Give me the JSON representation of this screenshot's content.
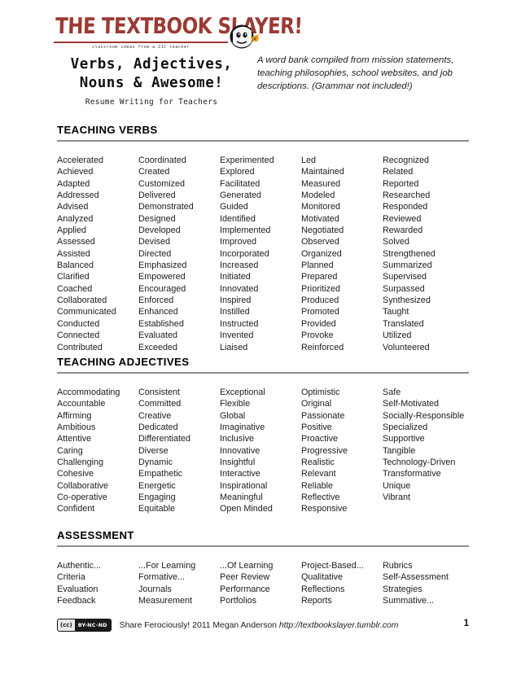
{
  "header": {
    "brand_title": "THE TEXTBOOK SLAYER!",
    "brand_tagline": "classroom  ideas from a 21C teacher",
    "brand_color": "#9b3a33",
    "doc_title_line1": "Verbs, Adjectives,",
    "doc_title_line2": "Nouns & Awesome!",
    "doc_subtitle": "Resume Writing for Teachers",
    "blurb": "A word bank compiled from mission statements, teaching philosophies, school websites, and job descriptions. (Grammar not included!)",
    "mascot_icon": "slayer-mascot-icon"
  },
  "sections": [
    {
      "id": "verbs",
      "title": "TEACHING VERBS",
      "columns": [
        [
          "Accelerated",
          "Achieved",
          "Adapted",
          "Addressed",
          "Advised",
          "Analyzed",
          "Applied",
          "Assessed",
          "Assisted",
          "Balanced",
          "Clarified",
          "Coached",
          "Collaborated",
          "Communicated",
          "Conducted",
          "Connected",
          "Contributed"
        ],
        [
          "Coordinated",
          "Created",
          "Customized",
          "Delivered",
          "Demonstrated",
          "Designed",
          "Developed",
          "Devised",
          "Directed",
          "Emphasized",
          "Empowered",
          "Encouraged",
          "Enforced",
          "Enhanced",
          "Established",
          "Evaluated",
          "Exceeded"
        ],
        [
          "Experimented",
          "Explored",
          "Facilitated",
          "Generated",
          "Guided",
          "Identified",
          "Implemented",
          "Improved",
          "Incorporated",
          "Increased",
          "Initiated",
          "Innovated",
          "Inspired",
          "Instilled",
          "Instructed",
          "Invented",
          "Liaised"
        ],
        [
          "Led",
          "Maintained",
          "Measured",
          "Modeled",
          "Monitored",
          "Motivated",
          "Negotiated",
          "Observed",
          "Organized",
          "Planned",
          "Prepared",
          "Prioritized",
          "Produced",
          "Promoted",
          "Provided",
          "Provoke",
          "Reinforced"
        ],
        [
          "Recognized",
          "Related",
          "Reported",
          "Researched",
          "Responded",
          "Reviewed",
          "Rewarded",
          "Solved",
          "Strengthened",
          "Summarized",
          "Supervised",
          "Surpassed",
          "Synthesized",
          "Taught",
          "Translated",
          "Utilized",
          "Volunteered"
        ]
      ]
    },
    {
      "id": "adjectives",
      "title": "TEACHING ADJECTIVES",
      "columns": [
        [
          "Accommodating",
          "Accountable",
          "Affirming",
          "Ambitious",
          "Attentive",
          "Caring",
          "Challenging",
          "Cohesive",
          "Collaborative",
          "Co-operative",
          "Confident"
        ],
        [
          "Consistent",
          "Committed",
          "Creative",
          "Dedicated",
          "Differentiated",
          "Diverse",
          "Dynamic",
          "Empathetic",
          "Energetic",
          "Engaging",
          "Equitable"
        ],
        [
          "Exceptional",
          "Flexible",
          "Global",
          "Imaginative",
          "Inclusive",
          "Innovative",
          "Insightful",
          "Interactive",
          "Inspirational",
          "Meaningful",
          "Open Minded"
        ],
        [
          "Optimistic",
          "Original",
          "Passionate",
          "Positive",
          "Proactive",
          "Progressive",
          "Realistic",
          "Relevant",
          "Reliable",
          "Reflective",
          "Responsive"
        ],
        [
          "Safe",
          "Self-Motivated",
          "Socially-Responsible",
          "Specialized",
          "Supportive",
          "Tangible",
          "Technology-Driven",
          "Transformative",
          "Unique",
          "Vibrant"
        ]
      ]
    },
    {
      "id": "assessment",
      "title": "ASSESSMENT",
      "columns": [
        [
          "Authentic...",
          "Criteria",
          "Evaluation",
          "Feedback"
        ],
        [
          "...For Learning",
          "Formative...",
          "Journals",
          "Measurement"
        ],
        [
          "...Of Learning",
          "Peer Review",
          "Performance",
          "Portfolios"
        ],
        [
          "Project-Based...",
          "Qualitative",
          "Reflections",
          "Reports"
        ],
        [
          "Rubrics",
          "Self-Assessment",
          "Strategies",
          "Summative..."
        ]
      ]
    }
  ],
  "footer": {
    "cc_mark": "(cc)",
    "cc_license": "BY-NC-ND",
    "credit": "Share Ferociously! 2011 Megan Anderson ",
    "url": "http://textbookslayer.tumblr.com",
    "page_number": "1"
  }
}
